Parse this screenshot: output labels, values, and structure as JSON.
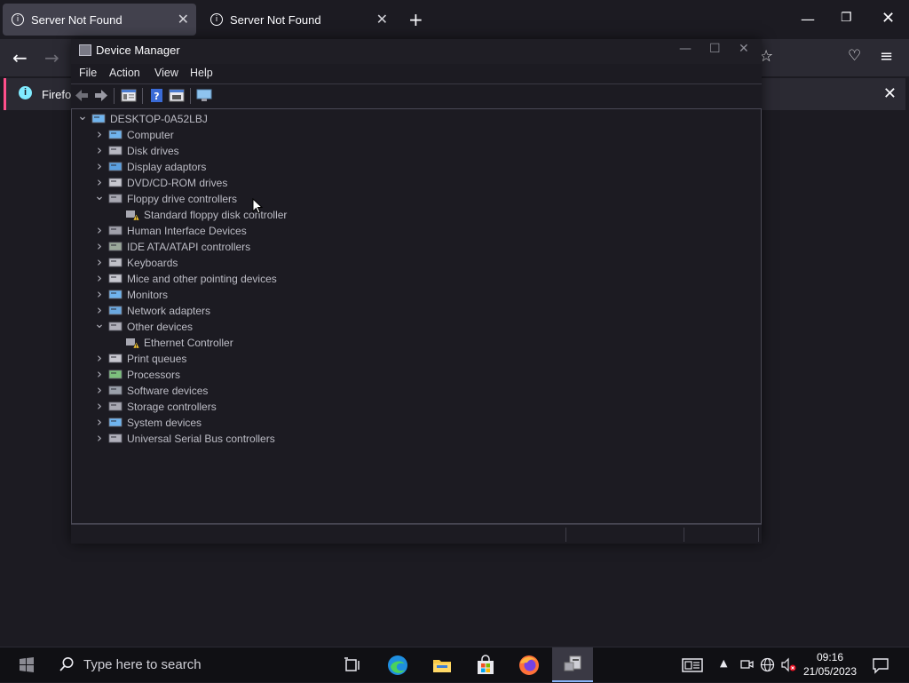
{
  "browser": {
    "tabs": [
      {
        "title": "Server Not Found",
        "active": true
      },
      {
        "title": "Server Not Found",
        "active": false
      }
    ],
    "notification": {
      "text": "Firefox"
    },
    "accent": "#ff4f8a"
  },
  "device_manager": {
    "title": "Device Manager",
    "menu": [
      "File",
      "Action",
      "View",
      "Help"
    ],
    "root": "DESKTOP-0A52LBJ",
    "tree": [
      {
        "label": "Computer",
        "expanded": false,
        "icon": "computer-icon"
      },
      {
        "label": "Disk drives",
        "expanded": false,
        "icon": "disk-drive-icon"
      },
      {
        "label": "Display adaptors",
        "expanded": false,
        "icon": "display-adapter-icon"
      },
      {
        "label": "DVD/CD-ROM drives",
        "expanded": false,
        "icon": "dvd-drive-icon"
      },
      {
        "label": "Floppy drive controllers",
        "expanded": true,
        "icon": "floppy-controller-icon",
        "children": [
          {
            "label": "Standard floppy disk controller",
            "icon": "warning-device-icon"
          }
        ]
      },
      {
        "label": "Human Interface Devices",
        "expanded": false,
        "icon": "hid-icon"
      },
      {
        "label": "IDE ATA/ATAPI controllers",
        "expanded": false,
        "icon": "ide-controller-icon"
      },
      {
        "label": "Keyboards",
        "expanded": false,
        "icon": "keyboard-icon"
      },
      {
        "label": "Mice and other pointing devices",
        "expanded": false,
        "icon": "mouse-icon"
      },
      {
        "label": "Monitors",
        "expanded": false,
        "icon": "monitor-icon"
      },
      {
        "label": "Network adapters",
        "expanded": false,
        "icon": "network-adapter-icon"
      },
      {
        "label": "Other devices",
        "expanded": true,
        "icon": "other-devices-icon",
        "children": [
          {
            "label": "Ethernet Controller",
            "icon": "warning-device-icon"
          }
        ]
      },
      {
        "label": "Print queues",
        "expanded": false,
        "icon": "printer-icon"
      },
      {
        "label": "Processors",
        "expanded": false,
        "icon": "processor-icon"
      },
      {
        "label": "Software devices",
        "expanded": false,
        "icon": "software-device-icon"
      },
      {
        "label": "Storage controllers",
        "expanded": false,
        "icon": "storage-controller-icon"
      },
      {
        "label": "System devices",
        "expanded": false,
        "icon": "system-devices-icon"
      },
      {
        "label": "Universal Serial Bus controllers",
        "expanded": false,
        "icon": "usb-icon"
      }
    ]
  },
  "taskbar": {
    "search_placeholder": "Type here to search",
    "time": "09:16",
    "date": "21/05/2023"
  }
}
